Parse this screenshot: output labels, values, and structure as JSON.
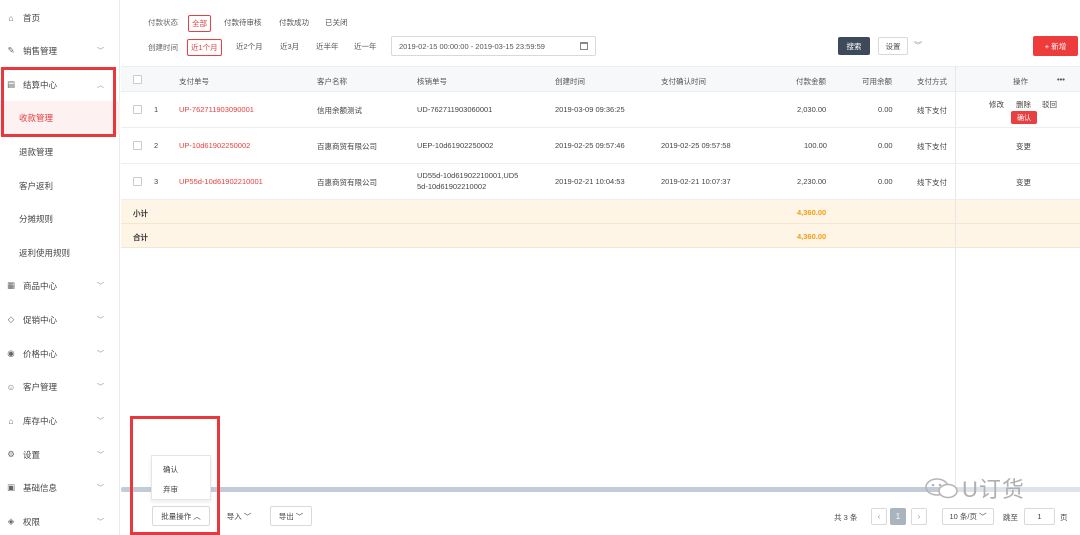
{
  "sidebar": {
    "items": [
      {
        "label": "首页",
        "icon": "home-icon",
        "glyph": "⌂",
        "chevron": false
      },
      {
        "label": "销售管理",
        "icon": "megaphone-icon",
        "glyph": "✎",
        "chevron": true
      },
      {
        "label": "结算中心",
        "icon": "settlement-icon",
        "glyph": "▤",
        "chevron": true,
        "expanded": true
      },
      {
        "label": "商品中心",
        "icon": "grid-icon",
        "glyph": "▦",
        "chevron": true
      },
      {
        "label": "促销中心",
        "icon": "tag-icon",
        "glyph": "◇",
        "chevron": true
      },
      {
        "label": "价格中心",
        "icon": "price-icon",
        "glyph": "◉",
        "chevron": true
      },
      {
        "label": "客户管理",
        "icon": "users-icon",
        "glyph": "☺",
        "chevron": true
      },
      {
        "label": "库存中心",
        "icon": "warehouse-icon",
        "glyph": "⌂",
        "chevron": true
      },
      {
        "label": "设置",
        "icon": "gear-icon",
        "glyph": "⚙",
        "chevron": true
      },
      {
        "label": "基础信息",
        "icon": "info-icon",
        "glyph": "▣",
        "chevron": true
      },
      {
        "label": "权限",
        "icon": "shield-icon",
        "glyph": "◈",
        "chevron": true
      }
    ],
    "subitems": [
      {
        "label": "收款管理",
        "active": true
      },
      {
        "label": "退款管理",
        "active": false
      },
      {
        "label": "客户返利",
        "active": false
      },
      {
        "label": "分摊规则",
        "active": false
      },
      {
        "label": "返利使用规则",
        "active": false
      }
    ]
  },
  "filters": {
    "status_label": "付款状态",
    "status_options": [
      "全部",
      "付款待审核",
      "付款成功",
      "已关闭"
    ],
    "time_label": "创建时间",
    "time_options": [
      "近1个月",
      "近2个月",
      "近3月",
      "近半年",
      "近一年"
    ],
    "date_range": "2019-02-15 00:00:00 - 2019-03-15 23:59:59",
    "search_label": "搜索",
    "settings_label": "设置",
    "new_label": "+ 新增"
  },
  "table": {
    "headers": [
      "支付单号",
      "客户名称",
      "核销单号",
      "创建时间",
      "支付确认时间",
      "付款金额",
      "可用余额",
      "支付方式",
      "操作"
    ],
    "more": "•••",
    "rows": [
      {
        "idx": "1",
        "pay_no": "UP-762711903090001",
        "customer": "信用余额测试",
        "verify_no": "UD-762711903060001",
        "created": "2019-03-09 09:36:25",
        "confirmed": "",
        "amount": "2,030.00",
        "balance": "0.00",
        "method": "线下支付"
      },
      {
        "idx": "2",
        "pay_no": "UP-10d61902250002",
        "customer": "百惠商贸有限公司",
        "verify_no": "UEP-10d61902250002",
        "created": "2019-02-25 09:57:46",
        "confirmed": "2019-02-25 09:57:58",
        "amount": "100.00",
        "balance": "0.00",
        "method": "线下支付"
      },
      {
        "idx": "3",
        "pay_no": "UP55d-10d61902210001",
        "customer": "百惠商贸有限公司",
        "verify_no_1": "UD55d-10d61902210001,UD5",
        "verify_no_2": "5d-10d61902210002",
        "created": "2019-02-21 10:04:53",
        "confirmed": "2019-02-21 10:07:37",
        "amount": "2,230.00",
        "balance": "0.00",
        "method": "线下支付"
      }
    ],
    "row1_ops": {
      "edit": "修改",
      "delete": "删除",
      "reject": "驳回",
      "confirm": "确认"
    },
    "row2_op": "变更",
    "row3_op": "变更",
    "subtotal_label": "小计",
    "subtotal_amount": "4,360.00",
    "total_label": "合计",
    "total_amount": "4,360.00"
  },
  "footer": {
    "batch_label": "批量操作 ︿",
    "batch_menu": [
      "确认",
      "弃审"
    ],
    "import_label": "导入 ﹀",
    "export_label": "导出 ﹀",
    "total_text": "共 3 条",
    "current_page": "1",
    "page_size": "10 条/页 ﹀",
    "goto_label": "跳至",
    "goto_value": "1",
    "page_suffix": "页"
  },
  "watermark": "U订货"
}
